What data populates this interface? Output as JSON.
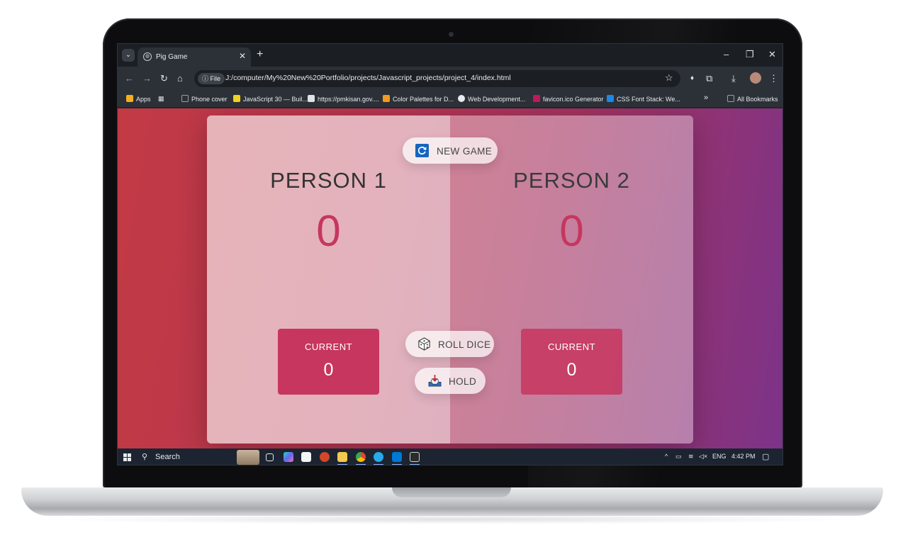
{
  "browser": {
    "tab_title": "Pig Game",
    "url_chip": "File",
    "url": "J:/computer/My%20New%20Portfolio/projects/Javascript_projects/project_4/index.html",
    "bookmarks": [
      {
        "label": "Apps",
        "color": "#f2b01e"
      },
      {
        "label": "Phone cover",
        "color": "#9aa0a6"
      },
      {
        "label": "JavaScript 30 — Buil...",
        "color": "#f2d21e"
      },
      {
        "label": "https://pmkisan.gov....",
        "color": "#dfe3e8"
      },
      {
        "label": "Color Palettes for D...",
        "color": "#f29b1e"
      },
      {
        "label": "Web Development...",
        "color": "#e8eaed"
      },
      {
        "label": "favicon.ico Generator",
        "color": "#c2185b"
      },
      {
        "label": "CSS Font Stack: We...",
        "color": "#1e88e5"
      }
    ],
    "all_bookmarks": "All Bookmarks"
  },
  "game": {
    "new_game_label": "NEW GAME",
    "roll_dice_label": "ROLL DICE",
    "hold_label": "HOLD",
    "players": [
      {
        "name": "PERSON 1",
        "score": "0",
        "current_label": "CURRENT",
        "current_score": "0"
      },
      {
        "name": "PERSON 2",
        "score": "0",
        "current_label": "CURRENT",
        "current_score": "0"
      }
    ],
    "accent_color": "#c7365f"
  },
  "taskbar": {
    "search_label": "Search",
    "language": "ENG",
    "time": "4:42 PM"
  }
}
